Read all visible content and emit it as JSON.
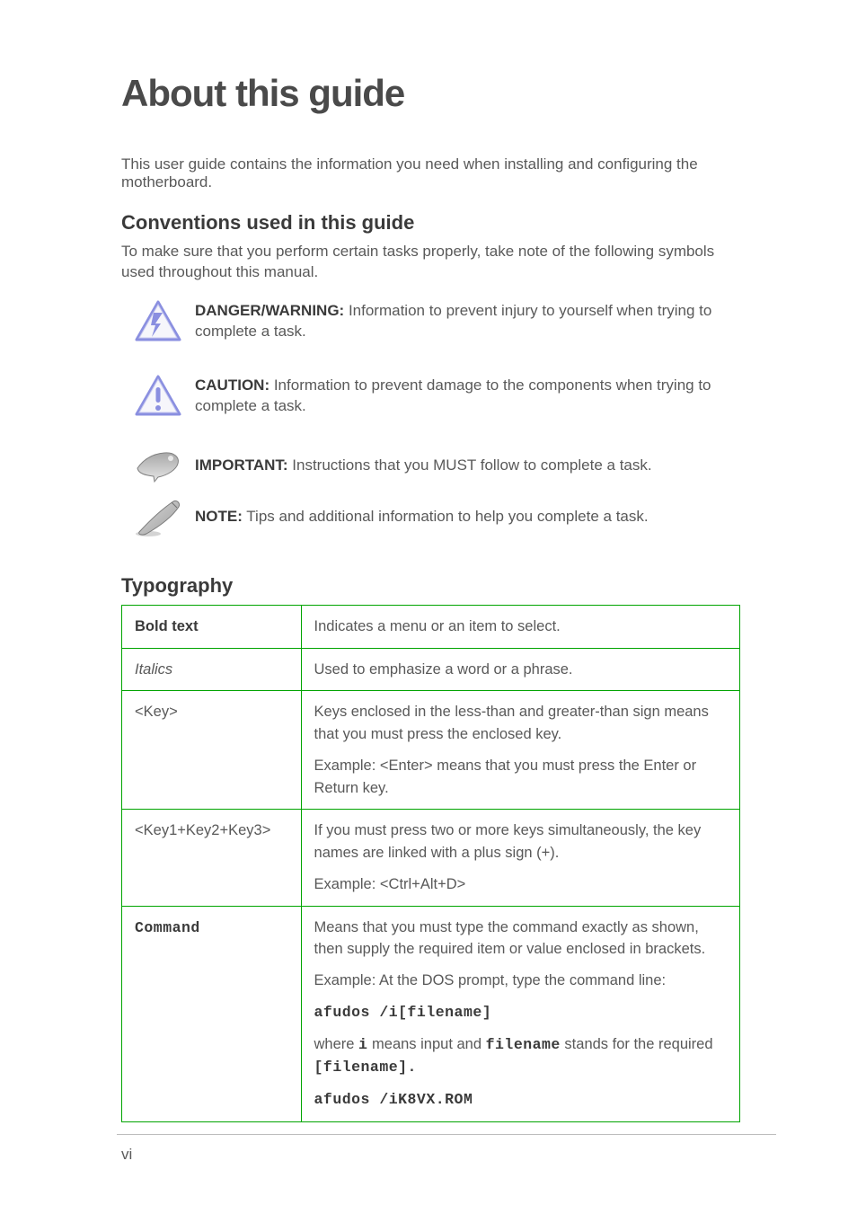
{
  "heading": "About this guide",
  "intro": "This user guide contains the information you need when installing and configuring the motherboard.",
  "conventions": {
    "title": "Conventions used in this guide",
    "sub": "To make sure that you perform certain tasks properly, take note of the following symbols used throughout this manual.",
    "items": [
      {
        "label": "DANGER/WARNING:",
        "text": " Information to prevent injury to yourself when trying to complete a task."
      },
      {
        "label": "CAUTION:",
        "text": " Information to prevent damage to the components when trying to complete a task."
      },
      {
        "label": "IMPORTANT:",
        "text": " Instructions that you MUST follow to complete a task."
      },
      {
        "label": "NOTE:",
        "text": " Tips and additional information to help you complete a task."
      }
    ]
  },
  "typography": {
    "title": "Typography",
    "rows": {
      "bold": {
        "left": "Bold text",
        "right": "Indicates a menu or an item to select."
      },
      "italic": {
        "left": "Italics",
        "right": "Used to emphasize a word or a phrase."
      },
      "keys1": {
        "left": "<Key>",
        "r1": "Keys enclosed in the less-than and greater-than sign means that you must press the enclosed key.",
        "r2a": "Example: ",
        "r2b": "<Enter>",
        "r2c": " means that you must press the Enter or Return key."
      },
      "keys2": {
        "left": "<Key1+Key2+Key3>",
        "r1": "If you must press two or more keys simultaneously, the key names are linked with a plus sign (+).",
        "r2a": "Example: ",
        "r2b": "<Ctrl+Alt+D>"
      },
      "command": {
        "left": "Command",
        "r1": "Means that you must type the command exactly as shown, then supply the required item or value enclosed in brackets.",
        "r2": "Example: At the DOS prompt, type the command line:",
        "code1": "afudos /i[filename]",
        "mid1a": "where ",
        "mid1b": "i",
        "mid1c": " means input and ",
        "mid1d": "filename",
        "mid1e": " stands for the required ",
        "mid2": "[filename].",
        "code2": "afudos /iK8VX.ROM"
      }
    }
  },
  "pagenum": "vi"
}
